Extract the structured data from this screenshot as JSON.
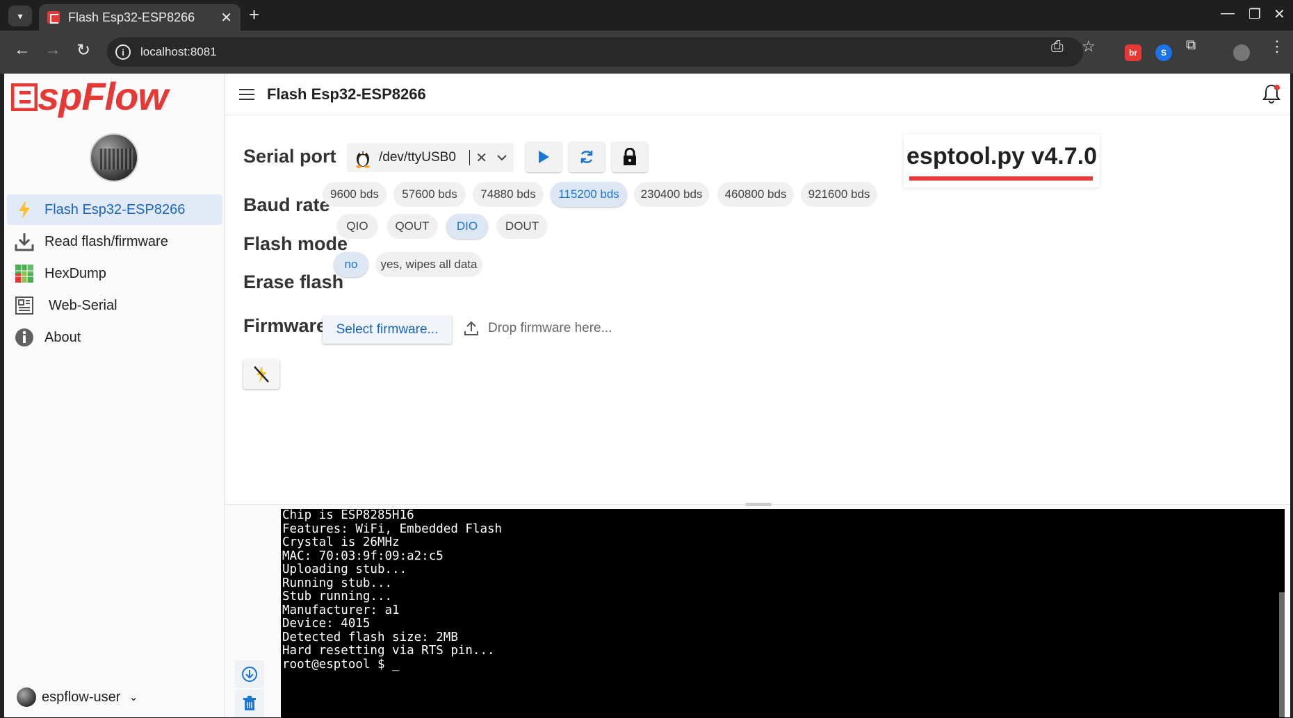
{
  "browser": {
    "tab_title": "Flash Esp32-ESP8266",
    "url": "localhost:8081",
    "extensions": [
      "br",
      "shazam"
    ]
  },
  "app": {
    "logo_text": "spFlow",
    "logo_letter": "E",
    "brand_color": "#e53935",
    "accent_color": "#1976d2"
  },
  "sidebar": {
    "items": [
      {
        "label": "Flash Esp32-ESP8266",
        "icon": "bolt-icon",
        "active": true
      },
      {
        "label": "Read flash/firmware",
        "icon": "download-icon",
        "active": false
      },
      {
        "label": "HexDump",
        "icon": "hexdump-icon",
        "active": false
      },
      {
        "label": "Web-Serial",
        "icon": "web-serial-icon",
        "active": false
      },
      {
        "label": "About",
        "icon": "info-icon",
        "active": false
      }
    ],
    "user": "espflow-user"
  },
  "header": {
    "title": "Flash Esp32-ESP8266"
  },
  "form": {
    "serial_port_label": "Serial port",
    "serial_port_value": "/dev/ttyUSB0",
    "baud_rate_label": "Baud rate",
    "baud_rates": [
      "9600 bds",
      "57600 bds",
      "74880 bds",
      "115200 bds",
      "230400 bds",
      "460800 bds",
      "921600 bds"
    ],
    "baud_selected": "115200 bds",
    "flash_mode_label": "Flash mode",
    "flash_modes": [
      "QIO",
      "QOUT",
      "DIO",
      "DOUT"
    ],
    "flash_mode_selected": "DIO",
    "erase_flash_label": "Erase flash",
    "erase_options": [
      "no",
      "yes, wipes all data"
    ],
    "erase_selected": "no",
    "firmware_label": "Firmware",
    "select_firmware": "Select firmware...",
    "drop_firmware": "Drop firmware here..."
  },
  "esptool_version": "esptool.py v4.7.0",
  "terminal": {
    "lines": [
      "Chip is ESP8285H16",
      "Features: WiFi, Embedded Flash",
      "Crystal is 26MHz",
      "MAC: 70:03:9f:09:a2:c5",
      "Uploading stub...",
      "Running stub...",
      "Stub running...",
      "Manufacturer: a1",
      "Device: 4015",
      "Detected flash size: 2MB",
      "Hard resetting via RTS pin...",
      "root@esptool $ _"
    ]
  }
}
